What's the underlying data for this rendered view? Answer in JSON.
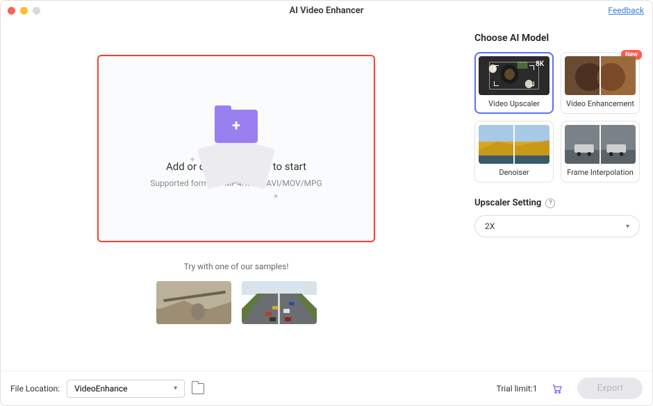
{
  "window": {
    "title": "AI Video Enhancer",
    "feedback": "Feedback"
  },
  "dropzone": {
    "title": "Add or drag video here to start",
    "subtitle": "Supported formats: MP4/MKV/AVI/MOV/MPG"
  },
  "samples": {
    "label": "Try with one of our samples!"
  },
  "models": {
    "heading": "Choose AI Model",
    "items": [
      {
        "label": "Video Upscaler",
        "selected": true
      },
      {
        "label": "Video Enhancement",
        "badge": "New"
      },
      {
        "label": "Denoiser"
      },
      {
        "label": "Frame Interpolation"
      }
    ]
  },
  "upscaler": {
    "heading": "Upscaler Setting",
    "value": "2X"
  },
  "footer": {
    "location_label": "File Location:",
    "location_value": "VideoEnhance",
    "trial": "Trial limit:1",
    "export": "Export"
  }
}
